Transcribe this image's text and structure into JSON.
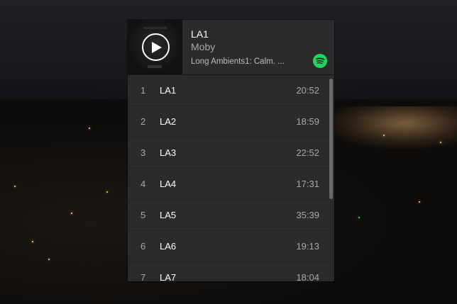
{
  "player": {
    "title": "LA1",
    "artist": "Moby",
    "album": "Long Ambients1: Calm. ...",
    "accent_color": "#1ed760"
  },
  "icons": {
    "play": "play-icon",
    "spotify": "spotify-logo-icon"
  },
  "tracks": [
    {
      "number": "1",
      "name": "LA1",
      "duration": "20:52"
    },
    {
      "number": "2",
      "name": "LA2",
      "duration": "18:59"
    },
    {
      "number": "3",
      "name": "LA3",
      "duration": "22:52"
    },
    {
      "number": "4",
      "name": "LA4",
      "duration": "17:31"
    },
    {
      "number": "5",
      "name": "LA5",
      "duration": "35:39"
    },
    {
      "number": "6",
      "name": "LA6",
      "duration": "19:13"
    },
    {
      "number": "7",
      "name": "LA7",
      "duration": "18:04"
    }
  ]
}
